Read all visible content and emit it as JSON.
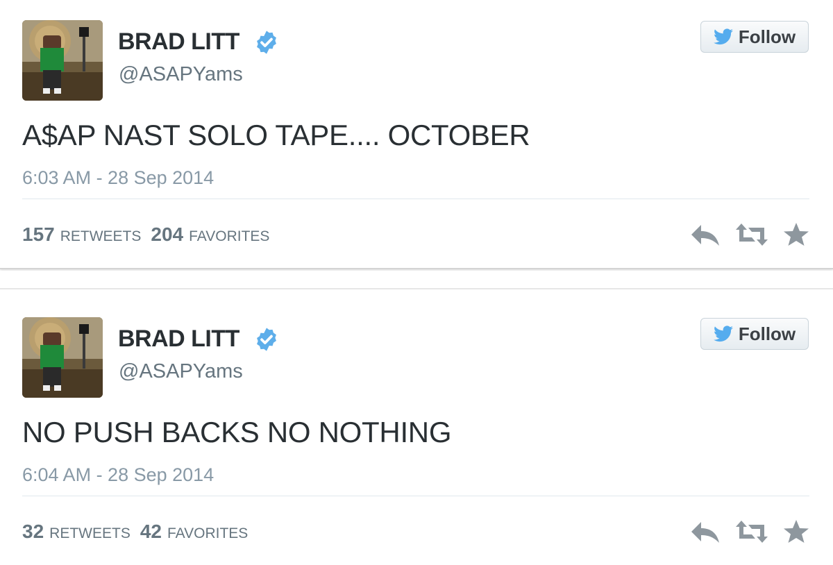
{
  "tweets": [
    {
      "display_name": "BRAD LITT",
      "handle": "@ASAPYams",
      "follow_label": "Follow",
      "text": "A$AP NAST SOLO TAPE.... OCTOBER",
      "timestamp": "6:03 AM - 28 Sep 2014",
      "retweets_count": "157",
      "retweets_label": "RETWEETS",
      "favorites_count": "204",
      "favorites_label": "FAVORITES"
    },
    {
      "display_name": "BRAD LITT",
      "handle": "@ASAPYams",
      "follow_label": "Follow",
      "text": "NO PUSH BACKS NO NOTHING",
      "timestamp": "6:04 AM - 28 Sep 2014",
      "retweets_count": "32",
      "retweets_label": "RETWEETS",
      "favorites_count": "42",
      "favorites_label": "FAVORITES"
    }
  ],
  "icons": {
    "verified": "verified-badge-icon",
    "follow": "twitter-bird-icon",
    "reply": "reply-icon",
    "retweet": "retweet-icon",
    "favorite": "star-icon"
  },
  "colors": {
    "twitter_blue": "#55acee",
    "verified_blue": "#5eaeea",
    "action_gray": "#8e979e",
    "meta_gray": "#8899a6"
  }
}
